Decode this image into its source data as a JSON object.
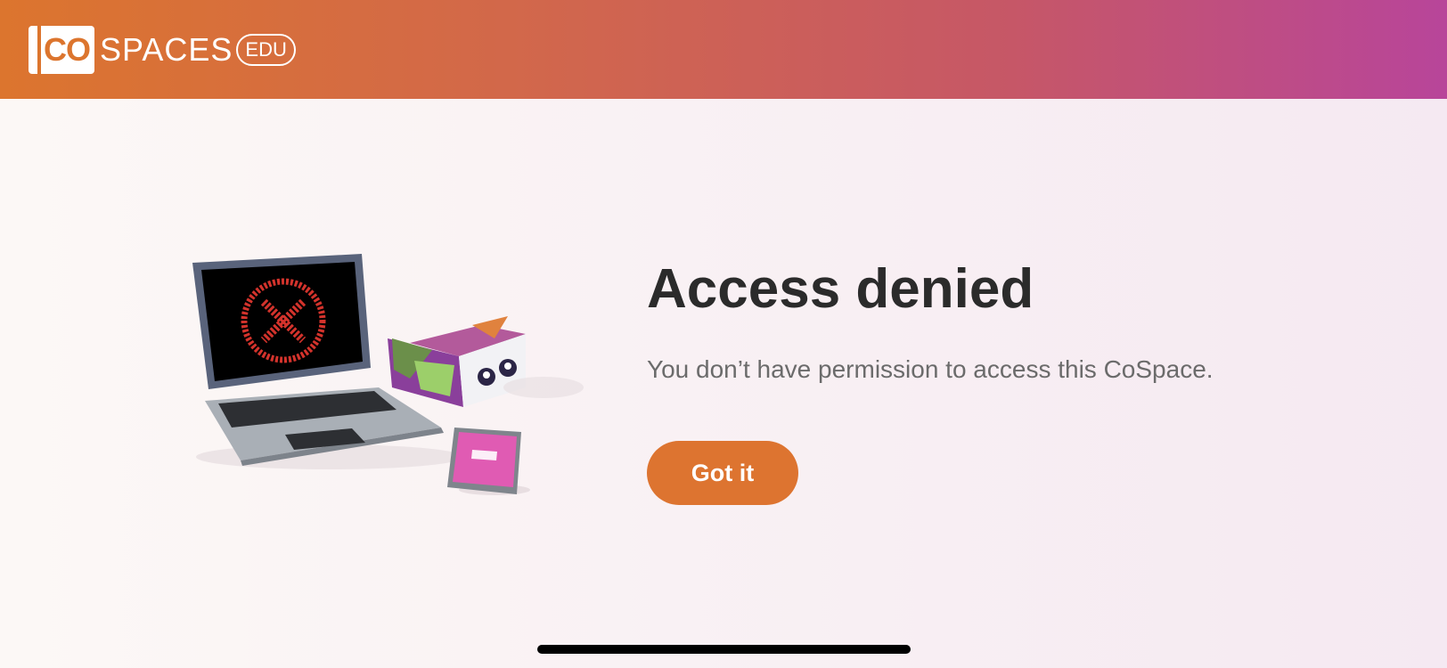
{
  "header": {
    "logo": {
      "mark": "CO",
      "word": "SPACES",
      "badge": "EDU"
    }
  },
  "illustration": {
    "icon": "access-denied-devices-illustration",
    "colors": {
      "laptop_body": "#a8adb4",
      "laptop_screen": "#000000",
      "error_red": "#d4332c",
      "accent_purple": "#8a3f9b",
      "phone_screen": "#e05bb3"
    }
  },
  "main": {
    "title": "Access denied",
    "message": "You don’t have permission to access this CoSpace.",
    "button_label": "Got it"
  },
  "colors": {
    "accent": "#dd7430",
    "header_start": "#dc752e",
    "header_end": "#b8459a"
  }
}
